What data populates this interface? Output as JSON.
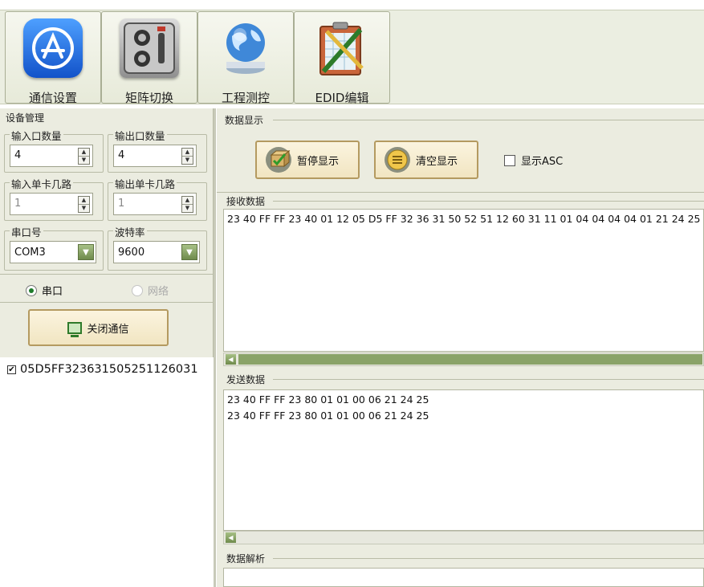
{
  "toolbar": {
    "buttons": [
      {
        "label": "通信设置",
        "icon": "app-store-icon"
      },
      {
        "label": "矩阵切换",
        "icon": "safe-icon"
      },
      {
        "label": "工程测控",
        "icon": "globe-icon"
      },
      {
        "label": "EDID编辑",
        "icon": "clipboard-icon"
      }
    ]
  },
  "left": {
    "section_title": "设备管理",
    "input_count": {
      "label": "输入口数量",
      "value": "4"
    },
    "output_count": {
      "label": "输出口数量",
      "value": "4"
    },
    "input_card": {
      "label": "输入单卡几路",
      "value": "1"
    },
    "output_card": {
      "label": "输出单卡几路",
      "value": "1"
    },
    "serial_port": {
      "label": "串口号",
      "value": "COM3"
    },
    "baud_rate": {
      "label": "波特率",
      "value": "9600"
    },
    "radio_serial": "串口",
    "radio_network": "网络",
    "close_button": "关闭通信",
    "checked_item": "05D5FF323631505251126031"
  },
  "right": {
    "section_title": "数据显示",
    "pause_button": "暂停显示",
    "clear_button": "清空显示",
    "show_asc": "显示ASC",
    "receive_title": "接收数据",
    "receive_lines": [
      "23 40 FF FF 23 40 01 12 05 D5 FF 32 36 31 50 52 51 12 60 31 11 01 04 04 04 04 01 21 24 25"
    ],
    "send_title": "发送数据",
    "send_lines": [
      "23 40 FF FF 23 80 01 01 00 06 21 24 25",
      "23 40 FF FF 23 80 01 01 00 06 21 24 25"
    ],
    "parse_title": "数据解析"
  },
  "colors": {
    "panel_bg": "#ebece0",
    "accent_green": "#8aa368",
    "button_border": "#b49a60"
  }
}
